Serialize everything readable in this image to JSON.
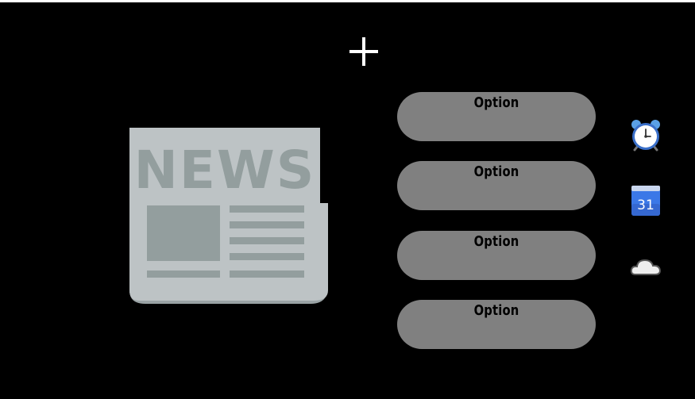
{
  "app": {
    "background_color": "#000000"
  },
  "add_button": {
    "icon": "plus-icon",
    "color": "#ffffff"
  },
  "news_image": {
    "icon": "newspaper-icon",
    "headline_text": "NEWS",
    "paper_color": "#bdc3c5",
    "ink_color": "#939e9e"
  },
  "options": [
    {
      "label": "Option"
    },
    {
      "label": "Option"
    },
    {
      "label": "Option"
    },
    {
      "label": "Option"
    }
  ],
  "option_style": {
    "background": "#808080",
    "text_color": "#000000"
  },
  "side_icons": [
    {
      "icon": "alarm-clock-icon"
    },
    {
      "icon": "calendar-icon",
      "text": "31",
      "color": "#3b78e7"
    },
    {
      "icon": "cloud-icon"
    }
  ]
}
